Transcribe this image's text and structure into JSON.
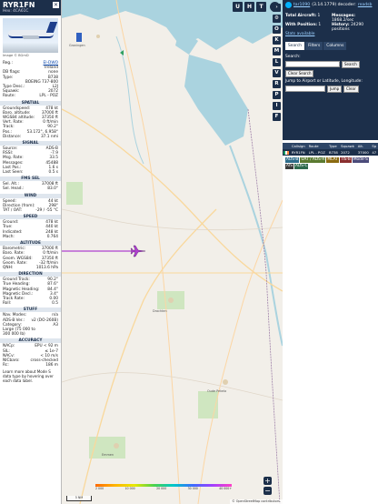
{
  "aircraft": {
    "callsign": "RYR1FN",
    "hex_label": "Hex:",
    "hex": "4CA61C",
    "image_credit": "Image © BGmD",
    "close_glyph": "✕"
  },
  "details": [
    {
      "label": "Reg.:",
      "value": "EI-DWO",
      "link": true
    },
    {
      "label": "",
      "value": "Ireland"
    },
    {
      "label": "DB flags:",
      "value": "none"
    },
    {
      "label": "Type:",
      "value": "B738"
    },
    {
      "label": "",
      "value": "BOEING 737-800"
    },
    {
      "label": "Type Desc.:",
      "value": "L2J"
    },
    {
      "label": "Squawk:",
      "value": "2072"
    },
    {
      "label": "Route:",
      "value": "LPL - POZ"
    }
  ],
  "sections": [
    {
      "title": "SPATIAL",
      "rows": [
        [
          "Groundspeed:",
          "478 kt"
        ],
        [
          "Baro. altitude:",
          "37000 ft"
        ],
        [
          "WGS84 altitude:",
          "37350 ft"
        ],
        [
          "Vert. Rate:",
          "0 ft/min"
        ],
        [
          "Track:",
          "90.2°"
        ],
        [
          "Pos.:",
          "53.172°, 6.958°"
        ],
        [
          "Distance:",
          "37.1 nmi"
        ]
      ]
    },
    {
      "title": "SIGNAL",
      "rows": [
        [
          "Source:",
          "ADS-B"
        ],
        [
          "RSSI:",
          "-7.9"
        ],
        [
          "Msg. Rate:",
          "33.5"
        ],
        [
          "Messages:",
          "45488"
        ],
        [
          "Last Pos.:",
          "1.6 s"
        ],
        [
          "Last Seen:",
          "0.5 s"
        ]
      ]
    },
    {
      "title": "FMS SEL",
      "rows": [
        [
          "Sel. Alt.:",
          "37008 ft"
        ],
        [
          "Sel. Head.:",
          "83.0°"
        ]
      ]
    },
    {
      "title": "WIND",
      "rows": [
        [
          "Speed:",
          "44 kt"
        ],
        [
          "Direction (from):",
          "298°"
        ],
        [
          "TAT / OAT:",
          "-29 / -55 °C"
        ]
      ]
    },
    {
      "title": "SPEED",
      "rows": [
        [
          "Ground:",
          "478 kt"
        ],
        [
          "True:",
          "440 kt"
        ],
        [
          "Indicated:",
          "248 kt"
        ],
        [
          "Mach:",
          "0.764"
        ]
      ]
    },
    {
      "title": "ALTITUDE",
      "rows": [
        [
          "Barometric:",
          "37000 ft"
        ],
        [
          "Baro. Rate:",
          "0 ft/min"
        ],
        [
          "Geom. WGS84:",
          "37350 ft"
        ],
        [
          "Geom. Rate:",
          "-32 ft/min"
        ],
        [
          "QNH:",
          "1013.6 hPa"
        ]
      ]
    },
    {
      "title": "DIRECTION",
      "rows": [
        [
          "Ground Track:",
          "90.2°"
        ],
        [
          "True Heading:",
          "87.6°"
        ],
        [
          "Magnetic Heading:",
          "84.4°"
        ],
        [
          "Magnetic Decl.:",
          "3.4°"
        ],
        [
          "Track Rate:",
          "0.00"
        ],
        [
          "Roll:",
          "0.5"
        ]
      ]
    },
    {
      "title": "STUFF",
      "rows": [
        [
          "Nav. Modes:",
          "n/a"
        ],
        [
          "ADS-B Ver.:",
          "v2 (DO-260B)"
        ],
        [
          "Category:",
          "A3"
        ],
        [
          "Large (75 000 to",
          ""
        ],
        [
          "300 000 lb)",
          ""
        ]
      ]
    },
    {
      "title": "ACCURACY",
      "rows": [
        [
          "NACp:",
          "EPU < 92 m"
        ],
        [
          "SIL:",
          "≤ 1e-7"
        ],
        [
          "NACv:",
          "< 10 m/s"
        ],
        [
          "NICbaro:",
          "cross-checked"
        ],
        [
          "Rc:",
          "186 m"
        ]
      ]
    }
  ],
  "footer_note": "Learn more about Mode S data type by hovering over each data label.",
  "map": {
    "top_buttons": [
      "U",
      "H",
      "T"
    ],
    "side_buttons": [
      "O",
      "K",
      "M",
      "L",
      "V",
      "R",
      "P",
      "I",
      "F"
    ],
    "zoom_in": "+",
    "zoom_out": "−",
    "scale_label": "5 NM",
    "altitude_ticks": [
      "2 000",
      "10 000",
      "20 000",
      "30 000",
      "40 000+"
    ],
    "attribution": "© OpenStreetMap contributors.",
    "info_glyph": "i",
    "place_labels": [
      "Groningen",
      "Drachten",
      "Oude Pekela",
      "Emmen"
    ]
  },
  "right_panel": {
    "title_link": "tar1090",
    "title_suffix": "(3.14.1779) decoder:",
    "title_link2": "readsb",
    "stats": {
      "total_label": "Total Aircraft:",
      "total_value": "1",
      "messages_label": "Messages:",
      "messages_value": "1868.2/sec",
      "pos_label": "With Position:",
      "pos_value": "1",
      "history_label": "History:",
      "history_value": "24290 positions",
      "stats_link": "Stats available"
    },
    "tabs": [
      "Search",
      "Filters",
      "Columns"
    ],
    "search_label": "Search:",
    "search_button": "Search",
    "clear_button": "Clear Search",
    "jump_label": "Jump to Airport or Latitude, Longitude:",
    "jump_button": "Jump",
    "jump_clear": "Clear",
    "columns": [
      "",
      "Callsign",
      "Route",
      "Type",
      "Squawk",
      "Alt.",
      "Sp"
    ],
    "rows": [
      {
        "callsign": "RYR1FN",
        "route": "LPL - POZ",
        "type": "B738",
        "squawk": "2072",
        "alt": "37000",
        "spd": "47"
      }
    ],
    "sources": [
      {
        "label": "ADS-B",
        "color": "#2d6c8a"
      },
      {
        "label": "UAT / ADS-R",
        "color": "#5a7a30"
      },
      {
        "label": "MLAT",
        "color": "#8a6a10"
      },
      {
        "label": "TIS-B",
        "color": "#8a2f2f"
      },
      {
        "label": "Mode-S",
        "color": "#4b4b7a"
      },
      {
        "label": "AIS",
        "color": "#3a3a3a"
      },
      {
        "label": "ADS-C",
        "color": "#2e6b4d"
      }
    ]
  }
}
